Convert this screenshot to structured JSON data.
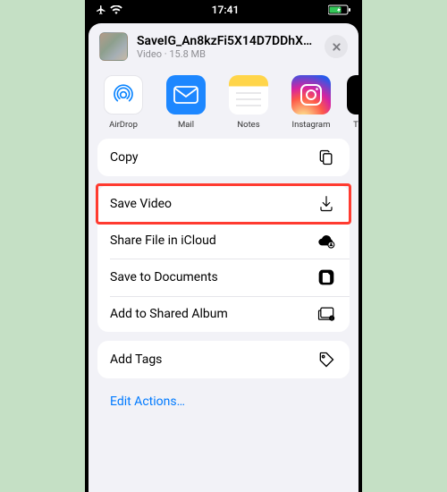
{
  "statusbar": {
    "time": "17:41"
  },
  "file": {
    "title": "SaveIG_An8kzFi5X14D7DDhXM...",
    "type": "Video",
    "size": "15.8 MB"
  },
  "apps": [
    {
      "label": "AirDrop"
    },
    {
      "label": "Mail"
    },
    {
      "label": "Notes"
    },
    {
      "label": "Instagram"
    },
    {
      "label": "T"
    }
  ],
  "actions": {
    "copy": "Copy",
    "save_video": "Save Video",
    "share_icloud": "Share File in iCloud",
    "save_documents": "Save to Documents",
    "add_shared_album": "Add to Shared Album",
    "add_tags": "Add Tags"
  },
  "edit_actions": "Edit Actions…"
}
